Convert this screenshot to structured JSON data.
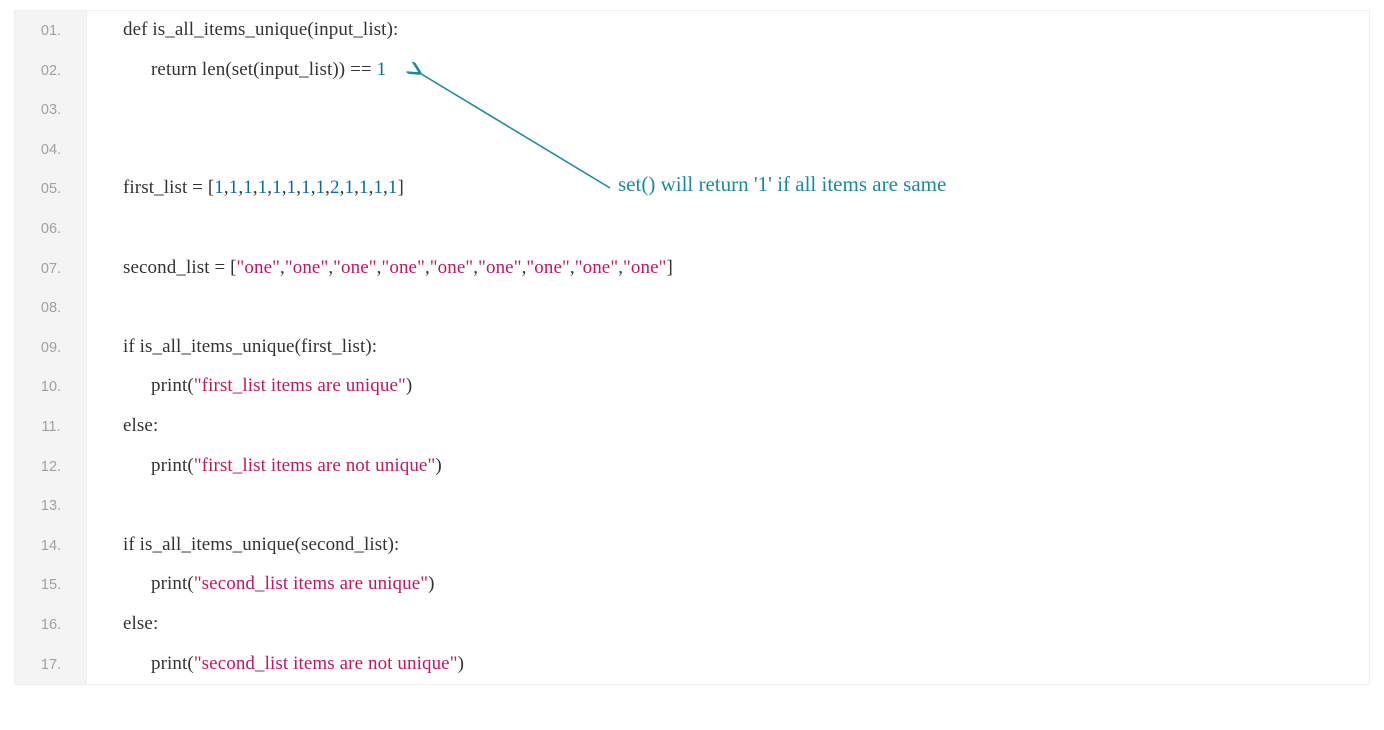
{
  "code": {
    "line_count": 17,
    "lines": [
      {
        "n": "01.",
        "indent": 0,
        "tokens": [
          {
            "t": "def is_all_items_unique(input_list):",
            "c": "tok-plain"
          }
        ]
      },
      {
        "n": "02.",
        "indent": 1,
        "tokens": [
          {
            "t": "return len(set(input_list)) == ",
            "c": "tok-plain"
          },
          {
            "t": "1",
            "c": "tok-num"
          }
        ]
      },
      {
        "n": "03.",
        "indent": 0,
        "tokens": []
      },
      {
        "n": "04.",
        "indent": 0,
        "tokens": []
      },
      {
        "n": "05.",
        "indent": 0,
        "tokens": [
          {
            "t": "first_list = [",
            "c": "tok-plain"
          },
          {
            "t": "1",
            "c": "tok-num"
          },
          {
            "t": ",",
            "c": "tok-plain"
          },
          {
            "t": "1",
            "c": "tok-num"
          },
          {
            "t": ",",
            "c": "tok-plain"
          },
          {
            "t": "1",
            "c": "tok-num"
          },
          {
            "t": ",",
            "c": "tok-plain"
          },
          {
            "t": "1",
            "c": "tok-num"
          },
          {
            "t": ",",
            "c": "tok-plain"
          },
          {
            "t": "1",
            "c": "tok-num"
          },
          {
            "t": ",",
            "c": "tok-plain"
          },
          {
            "t": "1",
            "c": "tok-num"
          },
          {
            "t": ",",
            "c": "tok-plain"
          },
          {
            "t": "1",
            "c": "tok-num"
          },
          {
            "t": ",",
            "c": "tok-plain"
          },
          {
            "t": "1",
            "c": "tok-num"
          },
          {
            "t": ",",
            "c": "tok-plain"
          },
          {
            "t": "2",
            "c": "tok-num"
          },
          {
            "t": ",",
            "c": "tok-plain"
          },
          {
            "t": "1",
            "c": "tok-num"
          },
          {
            "t": ",",
            "c": "tok-plain"
          },
          {
            "t": "1",
            "c": "tok-num"
          },
          {
            "t": ",",
            "c": "tok-plain"
          },
          {
            "t": "1",
            "c": "tok-num"
          },
          {
            "t": ",",
            "c": "tok-plain"
          },
          {
            "t": "1",
            "c": "tok-num"
          },
          {
            "t": "]",
            "c": "tok-plain"
          }
        ]
      },
      {
        "n": "06.",
        "indent": 0,
        "tokens": []
      },
      {
        "n": "07.",
        "indent": 0,
        "tokens": [
          {
            "t": "second_list = [",
            "c": "tok-plain"
          },
          {
            "t": "\"one\"",
            "c": "tok-str"
          },
          {
            "t": ",",
            "c": "tok-plain"
          },
          {
            "t": "\"one\"",
            "c": "tok-str"
          },
          {
            "t": ",",
            "c": "tok-plain"
          },
          {
            "t": "\"one\"",
            "c": "tok-str"
          },
          {
            "t": ",",
            "c": "tok-plain"
          },
          {
            "t": "\"one\"",
            "c": "tok-str"
          },
          {
            "t": ",",
            "c": "tok-plain"
          },
          {
            "t": "\"one\"",
            "c": "tok-str"
          },
          {
            "t": ",",
            "c": "tok-plain"
          },
          {
            "t": "\"one\"",
            "c": "tok-str"
          },
          {
            "t": ",",
            "c": "tok-plain"
          },
          {
            "t": "\"one\"",
            "c": "tok-str"
          },
          {
            "t": ",",
            "c": "tok-plain"
          },
          {
            "t": "\"one\"",
            "c": "tok-str"
          },
          {
            "t": ",",
            "c": "tok-plain"
          },
          {
            "t": "\"one\"",
            "c": "tok-str"
          },
          {
            "t": "]",
            "c": "tok-plain"
          }
        ]
      },
      {
        "n": "08.",
        "indent": 0,
        "tokens": []
      },
      {
        "n": "09.",
        "indent": 0,
        "tokens": [
          {
            "t": "if is_all_items_unique(first_list):",
            "c": "tok-plain"
          }
        ]
      },
      {
        "n": "10.",
        "indent": 1,
        "tokens": [
          {
            "t": "print(",
            "c": "tok-plain"
          },
          {
            "t": "\"first_list items are unique\"",
            "c": "tok-str"
          },
          {
            "t": ")",
            "c": "tok-plain"
          }
        ]
      },
      {
        "n": "11.",
        "indent": 0,
        "tokens": [
          {
            "t": "else:",
            "c": "tok-plain"
          }
        ]
      },
      {
        "n": "12.",
        "indent": 1,
        "tokens": [
          {
            "t": "print(",
            "c": "tok-plain"
          },
          {
            "t": "\"first_list items are not unique\"",
            "c": "tok-str"
          },
          {
            "t": ")",
            "c": "tok-plain"
          }
        ]
      },
      {
        "n": "13.",
        "indent": 0,
        "tokens": []
      },
      {
        "n": "14.",
        "indent": 0,
        "tokens": [
          {
            "t": "if is_all_items_unique(second_list):",
            "c": "tok-plain"
          }
        ]
      },
      {
        "n": "15.",
        "indent": 1,
        "tokens": [
          {
            "t": "print(",
            "c": "tok-plain"
          },
          {
            "t": "\"second_list items are unique\"",
            "c": "tok-str"
          },
          {
            "t": ")",
            "c": "tok-plain"
          }
        ]
      },
      {
        "n": "16.",
        "indent": 0,
        "tokens": [
          {
            "t": "else:",
            "c": "tok-plain"
          }
        ]
      },
      {
        "n": "17.",
        "indent": 1,
        "tokens": [
          {
            "t": "print(",
            "c": "tok-plain"
          },
          {
            "t": "\"second_list items are not unique\"",
            "c": "tok-str"
          },
          {
            "t": ")",
            "c": "tok-plain"
          }
        ]
      }
    ]
  },
  "annotation": {
    "text": "set() will return '1' if all items are same",
    "color": "#1a8a9e"
  }
}
